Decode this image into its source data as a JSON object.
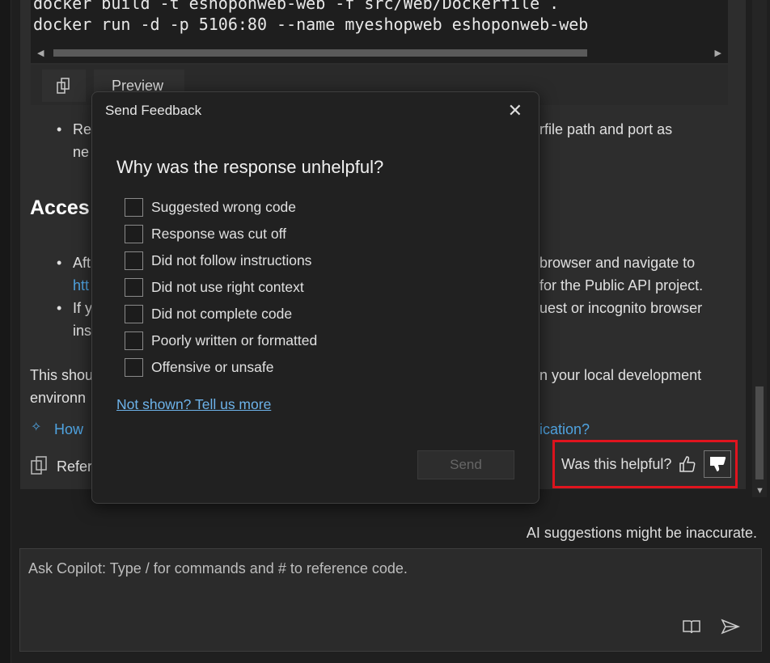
{
  "code": {
    "lines": [
      "docker build -t eshoponweb-web -f src/Web/Dockerfile .",
      "docker run -d -p 5106:80 --name myeshopweb eshoponweb-web"
    ],
    "preview_label": "Preview"
  },
  "background": {
    "l1_left": "Re",
    "l1_right": "rfile path and port as",
    "l2_left": "ne",
    "heading": "Acces",
    "l3_left": "Aft",
    "l3_right": "browser and navigate to",
    "l4_left": "htt",
    "l4_right": "for the Public API project.",
    "l5_left": "If y",
    "l5_right": "uest or incognito browser",
    "l6_left": "ins",
    "l7_left": "This shou",
    "l7_right": "n your local development",
    "l8_left": "environn",
    "suggest_left": "How",
    "suggest_right": "ication?",
    "refs_left": "Refer"
  },
  "feedback": {
    "label": "Was this helpful?",
    "highlight_color": "#e0141e"
  },
  "disclaimer": "AI suggestions might be inaccurate.",
  "ask": {
    "placeholder": "Ask Copilot: Type / for commands and # to reference code."
  },
  "dialog": {
    "title": "Send Feedback",
    "question": "Why was the response unhelpful?",
    "options": [
      "Suggested wrong code",
      "Response was cut off",
      "Did not follow instructions",
      "Did not use right context",
      "Did not complete code",
      "Poorly written or formatted",
      "Offensive or unsafe"
    ],
    "more_link": "Not shown? Tell us more",
    "send_label": "Send"
  }
}
